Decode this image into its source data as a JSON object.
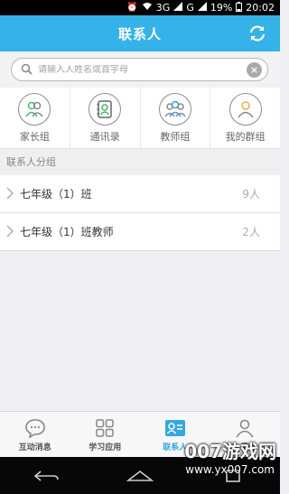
{
  "status_bar": {
    "network": "3G",
    "network2": "G",
    "battery": "19%",
    "time": "20:02"
  },
  "header": {
    "title": "联系人"
  },
  "search": {
    "placeholder": "请输入人姓名或首字母"
  },
  "quick_items": [
    {
      "label": "家长组",
      "icon": "parents-group-icon"
    },
    {
      "label": "通讯录",
      "icon": "address-book-icon"
    },
    {
      "label": "教师组",
      "icon": "teachers-group-icon"
    },
    {
      "label": "我的群组",
      "icon": "my-group-icon"
    }
  ],
  "section": {
    "title": "联系人分组"
  },
  "groups": [
    {
      "name": "七年级（1）班",
      "count": "9人"
    },
    {
      "name": "七年级（1）班教师",
      "count": "2人"
    }
  ],
  "tabs": [
    {
      "label": "互动消息",
      "icon": "chat-icon"
    },
    {
      "label": "学习应用",
      "icon": "apps-grid-icon"
    },
    {
      "label": "联系人",
      "icon": "contact-card-icon"
    },
    {
      "label": "我",
      "icon": "profile-icon"
    }
  ],
  "watermark": {
    "text": "007游戏网",
    "sub": "www.yx007.com"
  },
  "colors": {
    "accent": "#35b2e8",
    "active_tab": "#35a8e0"
  }
}
